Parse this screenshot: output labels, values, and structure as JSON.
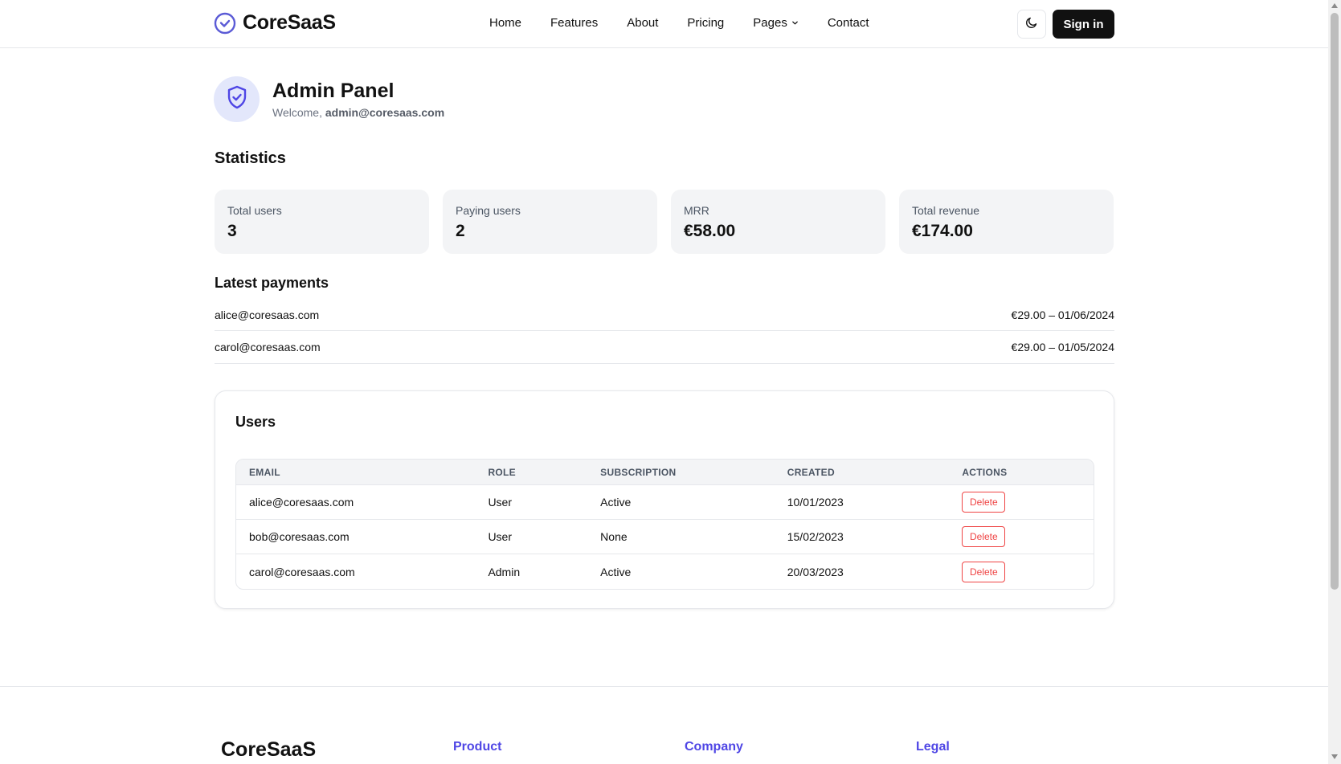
{
  "brand": {
    "name": "CoreSaaS",
    "accent": "#5b5bd6"
  },
  "nav": {
    "items": [
      {
        "label": "Home"
      },
      {
        "label": "Features"
      },
      {
        "label": "About"
      },
      {
        "label": "Pricing"
      },
      {
        "label": "Pages"
      },
      {
        "label": "Contact"
      }
    ],
    "sign_in": "Sign in"
  },
  "admin": {
    "title": "Admin Panel",
    "welcome_prefix": "Welcome,",
    "email": "admin@coresaas.com"
  },
  "statistics": {
    "title": "Statistics",
    "cards": [
      {
        "label": "Total users",
        "value": "3"
      },
      {
        "label": "Paying users",
        "value": "2"
      },
      {
        "label": "MRR",
        "value": "€58.00"
      },
      {
        "label": "Total revenue",
        "value": "€174.00"
      }
    ]
  },
  "payments": {
    "title": "Latest payments",
    "rows": [
      {
        "email": "alice@coresaas.com",
        "detail": "€29.00 – 01/06/2024"
      },
      {
        "email": "carol@coresaas.com",
        "detail": "€29.00 – 01/05/2024"
      }
    ]
  },
  "users": {
    "title": "Users",
    "columns": [
      "EMAIL",
      "ROLE",
      "SUBSCRIPTION",
      "CREATED",
      "ACTIONS"
    ],
    "rows": [
      {
        "email": "alice@coresaas.com",
        "role": "User",
        "subscription": "Active",
        "created": "10/01/2023",
        "action": "Delete"
      },
      {
        "email": "bob@coresaas.com",
        "role": "User",
        "subscription": "None",
        "created": "15/02/2023",
        "action": "Delete"
      },
      {
        "email": "carol@coresaas.com",
        "role": "Admin",
        "subscription": "Active",
        "created": "20/03/2023",
        "action": "Delete"
      }
    ],
    "delete_color": "#ef4444"
  },
  "footer": {
    "brand": "CoreSaaS",
    "columns": [
      "Product",
      "Company",
      "Legal"
    ],
    "column_color": "#4f46e5"
  }
}
